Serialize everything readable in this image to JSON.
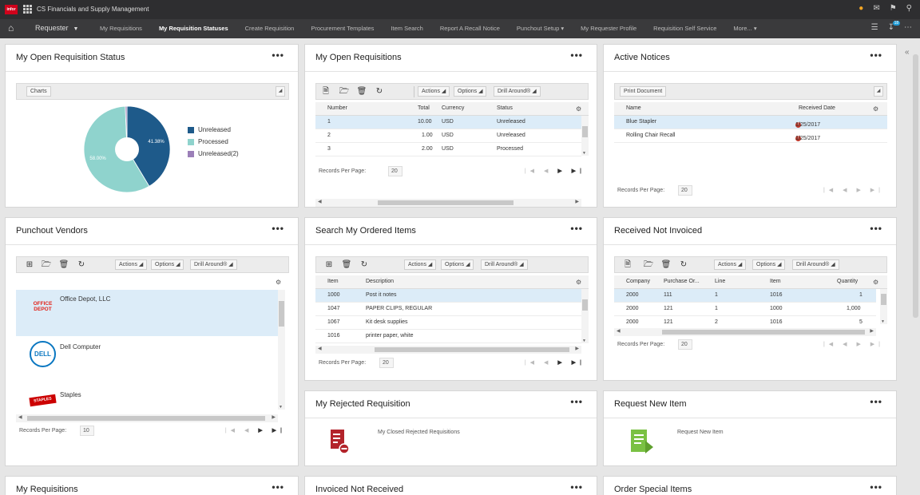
{
  "topbar": {
    "logo_text": "infor",
    "app_title": "CS Financials and Supply Management",
    "icons": [
      "user-icon",
      "message-icon",
      "bookmark-icon",
      "search-icon"
    ]
  },
  "navbar": {
    "role": "Requester",
    "items": [
      {
        "label": "My Requisitions",
        "active": false
      },
      {
        "label": "My Requisition Statuses",
        "active": true
      },
      {
        "label": "Create Requisition",
        "active": false
      },
      {
        "label": "Procurement Templates",
        "active": false
      },
      {
        "label": "Item Search",
        "active": false
      },
      {
        "label": "Report A Recall Notice",
        "active": false
      },
      {
        "label": "Punchout Setup",
        "active": false
      },
      {
        "label": "My Requester Profile",
        "active": false
      },
      {
        "label": "Requisition Self Service",
        "active": false
      },
      {
        "label": "More...",
        "active": false
      }
    ],
    "badge": "18"
  },
  "colors": {
    "unreleased": "#1e5a8a",
    "processed": "#8fd3cd",
    "unreleased2": "#9b7fb8",
    "accent": "#1f9bd6",
    "alert": "#c0392b",
    "pdf_icon": "#b3242b",
    "new_item_icon": "#7ac143"
  },
  "cards": {
    "open_status": {
      "title": "My Open Requisition Status",
      "charts_label": "Charts",
      "chart_data": {
        "type": "pie",
        "labels": [
          "Unreleased",
          "Processed",
          "Unreleased(2)"
        ],
        "values": [
          41.38,
          58.0,
          0.62
        ],
        "slice_labels": [
          "41.38%",
          "58.00%",
          ""
        ],
        "donut": true,
        "legend": "right"
      }
    },
    "open_requisitions": {
      "title": "My Open Requisitions",
      "buttons": {
        "actions": "Actions",
        "options": "Options",
        "drill": "Drill Around®"
      },
      "columns": [
        "Number",
        "Total",
        "Currency",
        "Status"
      ],
      "rows": [
        {
          "number": "1",
          "total": "10.00",
          "currency": "USD",
          "status": "Unreleased"
        },
        {
          "number": "2",
          "total": "1.00",
          "currency": "USD",
          "status": "Unreleased"
        },
        {
          "number": "3",
          "total": "2.00",
          "currency": "USD",
          "status": "Processed"
        }
      ],
      "records_label": "Records Per Page:",
      "records_value": "20"
    },
    "active_notices": {
      "title": "Active Notices",
      "print_label": "Print Document",
      "columns": [
        "Name",
        "Received Date"
      ],
      "rows": [
        {
          "name": "Blue Stapler",
          "date": "1/25/2017"
        },
        {
          "name": "Rolling Chair Recall",
          "date": "1/25/2017"
        }
      ],
      "records_label": "Records Per Page:",
      "records_value": "20"
    },
    "punchout_vendors": {
      "title": "Punchout Vendors",
      "buttons": {
        "actions": "Actions",
        "options": "Options",
        "drill": "Drill Around®"
      },
      "vendors": [
        {
          "name": "Office Depot, LLC",
          "logo": "OFFICE DEPOT"
        },
        {
          "name": "Dell Computer",
          "logo": "DELL"
        },
        {
          "name": "Staples",
          "logo": "STAPLES"
        }
      ],
      "records_label": "Records Per Page:",
      "records_value": "10"
    },
    "search_ordered": {
      "title": "Search My Ordered Items",
      "buttons": {
        "actions": "Actions",
        "options": "Options",
        "drill": "Drill Around®"
      },
      "columns": [
        "Item",
        "Description"
      ],
      "rows": [
        {
          "item": "1000",
          "description": "Post it notes"
        },
        {
          "item": "1047",
          "description": "PAPER CLIPS, REGULAR"
        },
        {
          "item": "1067",
          "description": "Kit desk supplies"
        },
        {
          "item": "1016",
          "description": "printer paper, white"
        }
      ],
      "records_label": "Records Per Page:",
      "records_value": "20"
    },
    "received_not_invoiced": {
      "title": "Received Not Invoiced",
      "buttons": {
        "actions": "Actions",
        "options": "Options",
        "drill": "Drill Around®"
      },
      "columns": [
        "Company",
        "Purchase Or...",
        "Line",
        "Item",
        "Quantity"
      ],
      "rows": [
        {
          "company": "2000",
          "po": "111",
          "line": "1",
          "item": "1016",
          "quantity": "1"
        },
        {
          "company": "2000",
          "po": "121",
          "line": "1",
          "item": "1000",
          "quantity": "1,000"
        },
        {
          "company": "2000",
          "po": "121",
          "line": "2",
          "item": "1016",
          "quantity": "5"
        }
      ],
      "records_label": "Records Per Page:",
      "records_value": "20"
    },
    "rejected": {
      "title": "My Rejected Requisition",
      "link_text": "My Closed Rejected Requisitions"
    },
    "request_new": {
      "title": "Request New Item",
      "link_text": "Request New Item"
    },
    "my_requisitions": {
      "title": "My Requisitions"
    },
    "invoiced_not_received": {
      "title": "Invoiced Not Received"
    },
    "order_special": {
      "title": "Order Special Items"
    }
  }
}
